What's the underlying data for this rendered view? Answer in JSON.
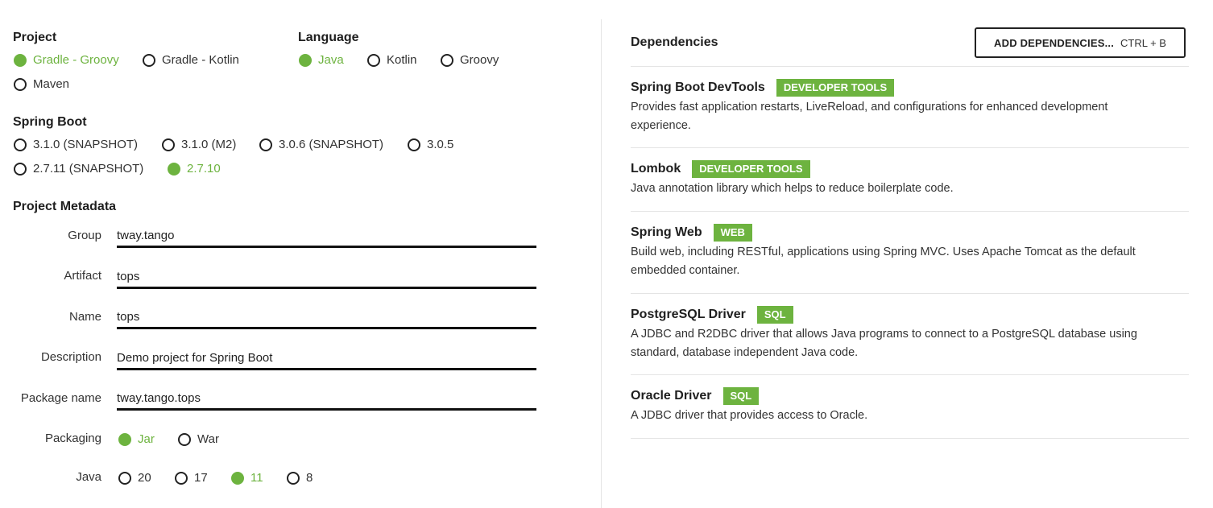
{
  "project": {
    "title": "Project",
    "options": [
      {
        "label": "Gradle - Groovy",
        "checked": true
      },
      {
        "label": "Gradle - Kotlin",
        "checked": false
      },
      {
        "label": "Maven",
        "checked": false
      }
    ]
  },
  "language": {
    "title": "Language",
    "options": [
      {
        "label": "Java",
        "checked": true
      },
      {
        "label": "Kotlin",
        "checked": false
      },
      {
        "label": "Groovy",
        "checked": false
      }
    ]
  },
  "spring_boot": {
    "title": "Spring Boot",
    "options": [
      {
        "label": "3.1.0 (SNAPSHOT)",
        "checked": false
      },
      {
        "label": "3.1.0 (M2)",
        "checked": false
      },
      {
        "label": "3.0.6 (SNAPSHOT)",
        "checked": false
      },
      {
        "label": "3.0.5",
        "checked": false
      },
      {
        "label": "2.7.11 (SNAPSHOT)",
        "checked": false
      },
      {
        "label": "2.7.10",
        "checked": true
      }
    ]
  },
  "metadata": {
    "title": "Project Metadata",
    "fields": [
      {
        "label": "Group",
        "value": "tway.tango"
      },
      {
        "label": "Artifact",
        "value": "tops"
      },
      {
        "label": "Name",
        "value": "tops"
      },
      {
        "label": "Description",
        "value": "Demo project for Spring Boot"
      },
      {
        "label": "Package name",
        "value": "tway.tango.tops"
      }
    ],
    "packaging": {
      "label": "Packaging",
      "options": [
        {
          "label": "Jar",
          "checked": true
        },
        {
          "label": "War",
          "checked": false
        }
      ]
    },
    "java": {
      "label": "Java",
      "options": [
        {
          "label": "20",
          "checked": false
        },
        {
          "label": "17",
          "checked": false
        },
        {
          "label": "11",
          "checked": true
        },
        {
          "label": "8",
          "checked": false
        }
      ]
    }
  },
  "dependencies": {
    "title": "Dependencies",
    "add_button": {
      "label": "ADD DEPENDENCIES...",
      "shortcut": "CTRL + B"
    },
    "items": [
      {
        "name": "Spring Boot DevTools",
        "tag": "DEVELOPER TOOLS",
        "description": "Provides fast application restarts, LiveReload, and configurations for enhanced development experience."
      },
      {
        "name": "Lombok",
        "tag": "DEVELOPER TOOLS",
        "description": "Java annotation library which helps to reduce boilerplate code."
      },
      {
        "name": "Spring Web",
        "tag": "WEB",
        "description": "Build web, including RESTful, applications using Spring MVC. Uses Apache Tomcat as the default embedded container."
      },
      {
        "name": "PostgreSQL Driver",
        "tag": "SQL",
        "description": "A JDBC and R2DBC driver that allows Java programs to connect to a PostgreSQL database using standard, database independent Java code."
      },
      {
        "name": "Oracle Driver",
        "tag": "SQL",
        "description": "A JDBC driver that provides access to Oracle."
      }
    ]
  },
  "colors": {
    "accent": "#6db33f",
    "text": "#222222",
    "divider": "#e4e4e4"
  }
}
